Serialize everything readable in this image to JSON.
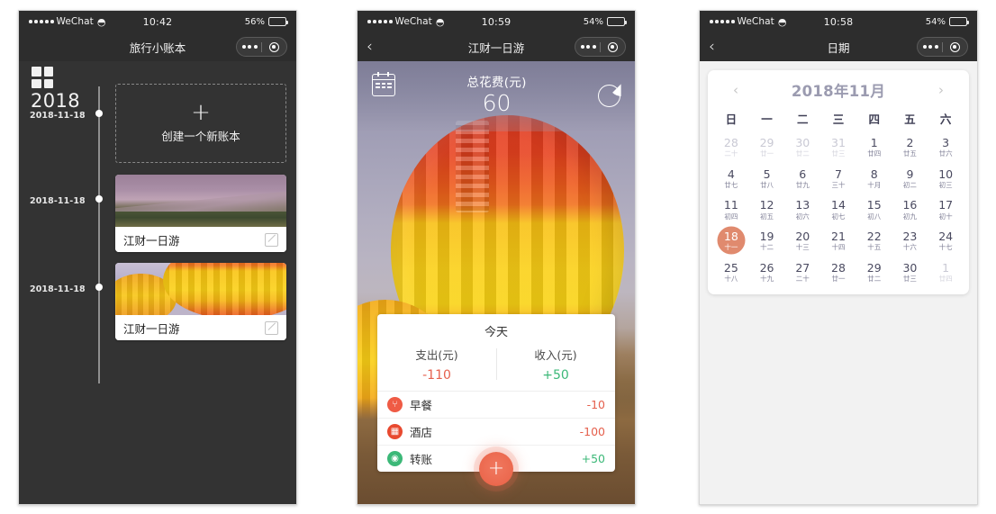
{
  "phones": [
    {
      "id": "account-book-list",
      "status": {
        "carrier": "WeChat",
        "wifi_icon": "wifi-icon",
        "time": "10:42",
        "battery_pct": "56%",
        "battery_level": 56
      },
      "nav": {
        "title": "旅行小账本",
        "back": "",
        "capsule": {
          "more": "more-dots-icon",
          "target": "target-circle-icon"
        }
      },
      "grid_icon": "grid-icon",
      "year": "2018",
      "create_card": {
        "plus": "+",
        "label": "创建一个新账本"
      },
      "timeline": [
        {
          "date": "2018-11-18"
        },
        {
          "date": "2018-11-18",
          "title": "江财一日游",
          "thumb": "dune-sunset",
          "edit": "edit-icon"
        },
        {
          "date": "2018-11-18",
          "title": "江财一日游",
          "thumb": "hot-air-balloon",
          "edit": "edit-icon"
        }
      ]
    },
    {
      "id": "trip-detail",
      "status": {
        "carrier": "WeChat",
        "wifi_icon": "wifi-icon",
        "time": "10:59",
        "battery_pct": "54%",
        "battery_level": 54
      },
      "nav": {
        "title": "江财一日游",
        "back": "‹",
        "capsule": {
          "more": "more-dots-icon",
          "target": "target-circle-icon"
        }
      },
      "hero": {
        "calendar_icon": "calendar-icon",
        "chart_icon": "pie-chart-icon",
        "total_label": "总花费(元)",
        "total_value": "60"
      },
      "summary": {
        "title": "今天",
        "expense_label": "支出(元)",
        "expense_value": "-110",
        "income_label": "收入(元)",
        "income_value": "+50"
      },
      "transactions": [
        {
          "icon": "food-icon",
          "name": "早餐",
          "amount": "-10",
          "sign": "neg"
        },
        {
          "icon": "hotel-icon",
          "name": "酒店",
          "amount": "-100",
          "sign": "neg"
        },
        {
          "icon": "transfer-icon",
          "name": "转账",
          "amount": "+50",
          "sign": "pos"
        }
      ],
      "fab": {
        "label": "+"
      }
    },
    {
      "id": "date-picker",
      "status": {
        "carrier": "WeChat",
        "wifi_icon": "wifi-icon",
        "time": "10:58",
        "battery_pct": "54%",
        "battery_level": 54
      },
      "nav": {
        "title": "日期",
        "back": "‹",
        "capsule": {
          "more": "more-dots-icon",
          "target": "target-circle-icon"
        }
      },
      "calendar": {
        "prev": "‹",
        "next": "›",
        "month_title": "2018年11月",
        "weekdays": [
          "日",
          "一",
          "二",
          "三",
          "四",
          "五",
          "六"
        ],
        "selected_day": 18,
        "days": [
          {
            "n": "28",
            "l": "二十",
            "muted": true
          },
          {
            "n": "29",
            "l": "廿一",
            "muted": true
          },
          {
            "n": "30",
            "l": "廿二",
            "muted": true
          },
          {
            "n": "31",
            "l": "廿三",
            "muted": true
          },
          {
            "n": "1",
            "l": "廿四",
            "muted": false
          },
          {
            "n": "2",
            "l": "廿五",
            "muted": false
          },
          {
            "n": "3",
            "l": "廿六",
            "muted": false
          },
          {
            "n": "4",
            "l": "廿七",
            "muted": false
          },
          {
            "n": "5",
            "l": "廿八",
            "muted": false
          },
          {
            "n": "6",
            "l": "廿九",
            "muted": false
          },
          {
            "n": "7",
            "l": "三十",
            "muted": false
          },
          {
            "n": "8",
            "l": "十月",
            "muted": false
          },
          {
            "n": "9",
            "l": "初二",
            "muted": false
          },
          {
            "n": "10",
            "l": "初三",
            "muted": false
          },
          {
            "n": "11",
            "l": "初四",
            "muted": false
          },
          {
            "n": "12",
            "l": "初五",
            "muted": false
          },
          {
            "n": "13",
            "l": "初六",
            "muted": false
          },
          {
            "n": "14",
            "l": "初七",
            "muted": false
          },
          {
            "n": "15",
            "l": "初八",
            "muted": false
          },
          {
            "n": "16",
            "l": "初九",
            "muted": false
          },
          {
            "n": "17",
            "l": "初十",
            "muted": false
          },
          {
            "n": "18",
            "l": "十一",
            "muted": false,
            "selected": true
          },
          {
            "n": "19",
            "l": "十二",
            "muted": false
          },
          {
            "n": "20",
            "l": "十三",
            "muted": false
          },
          {
            "n": "21",
            "l": "十四",
            "muted": false
          },
          {
            "n": "22",
            "l": "十五",
            "muted": false
          },
          {
            "n": "23",
            "l": "十六",
            "muted": false
          },
          {
            "n": "24",
            "l": "十七",
            "muted": false
          },
          {
            "n": "25",
            "l": "十八",
            "muted": false
          },
          {
            "n": "26",
            "l": "十九",
            "muted": false
          },
          {
            "n": "27",
            "l": "二十",
            "muted": false
          },
          {
            "n": "28",
            "l": "廿一",
            "muted": false
          },
          {
            "n": "29",
            "l": "廿二",
            "muted": false
          },
          {
            "n": "30",
            "l": "廿三",
            "muted": false
          },
          {
            "n": "1",
            "l": "廿四",
            "muted": true
          }
        ]
      }
    }
  ],
  "colors": {
    "nav_bar": "#2d2d2d",
    "phone1_bg": "#333333",
    "accent_selected_day": "#e08a6e",
    "fab": "#ec6a50",
    "expense_red": "#e5604d",
    "income_green": "#3cb878",
    "month_title": "#9b9bb0"
  }
}
